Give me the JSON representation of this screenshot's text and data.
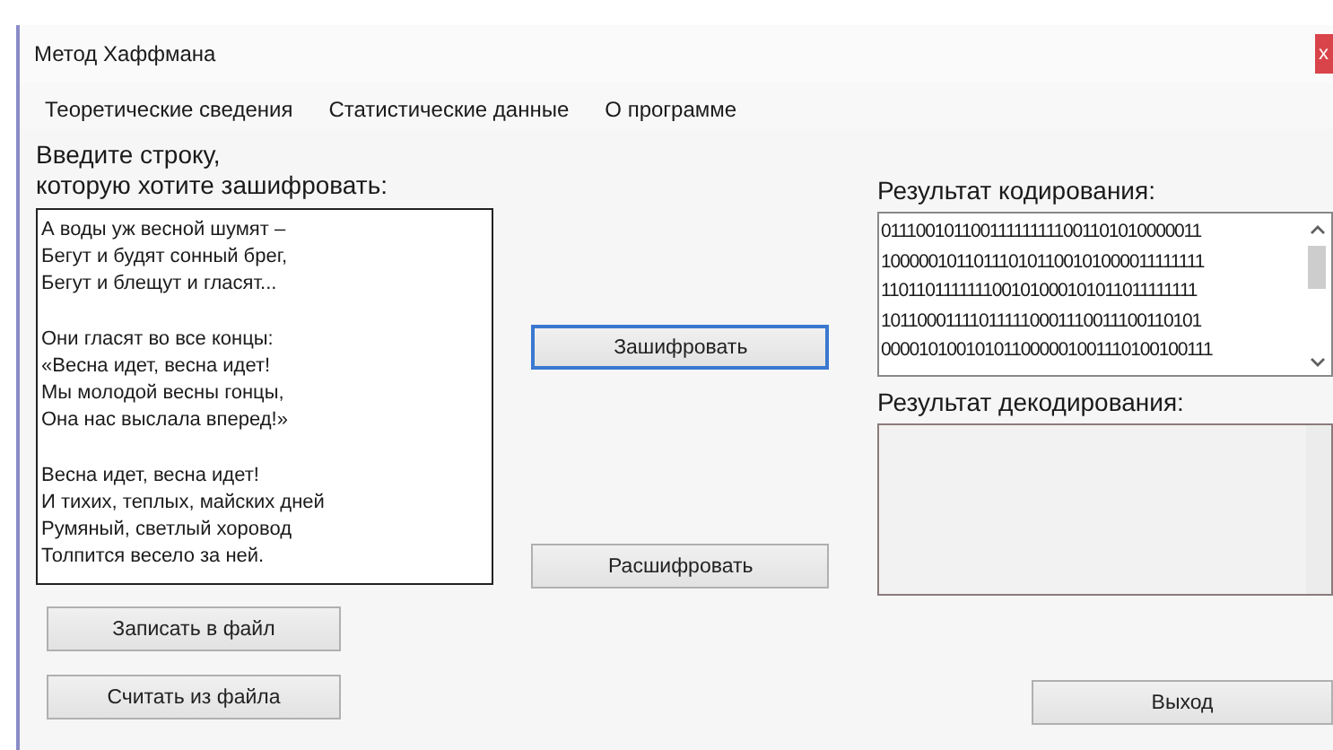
{
  "window": {
    "title": "Метод Хаффмана",
    "close": "x"
  },
  "menu": [
    {
      "label": "Теоретические сведения"
    },
    {
      "label": "Статистические данные"
    },
    {
      "label": "О программе"
    }
  ],
  "input": {
    "label_lines": [
      "Введите строку,",
      "которую хотите зашифровать:"
    ],
    "stanzas": [
      [
        "А воды уж весной шумят –",
        "Бегут и будят сонный брег,",
        "Бегут и блещут и гласят..."
      ],
      [
        "Они гласят во все концы:",
        "«Весна идет, весна идет!",
        "Мы молодой весны гонцы,",
        "Она нас выслала вперед!»"
      ],
      [
        "Весна идет, весна идет!",
        "И тихих, теплых, майских дней",
        "Румяный, светлый хоровод",
        "Толпится весело за ней."
      ]
    ]
  },
  "file_buttons": [
    "Записать в файл",
    "Считать из файла"
  ],
  "encode_button": {
    "label": "Зашифровать",
    "focused": true
  },
  "decode_button": {
    "label": "Расшифровать",
    "focused": false
  },
  "encoded": {
    "label": "Результат кодирования:",
    "lines": [
      "011100101100111111111001101010000011",
      "100000101101110101100101000011111111",
      "110110111111100101000101011011111111",
      "101100011110111110001110011100110101",
      "000010100101011000001001110100100111"
    ]
  },
  "decoded": {
    "label": "Результат декодирования:",
    "disabled": true
  },
  "exit_button": "Выход"
}
